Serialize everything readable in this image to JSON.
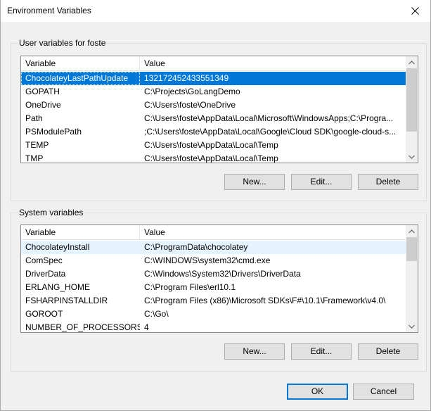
{
  "window": {
    "title": "Environment Variables"
  },
  "user_vars": {
    "group_label": "User variables for foste",
    "columns": [
      "Variable",
      "Value"
    ],
    "rows": [
      [
        "ChocolateyLastPathUpdate",
        "132172452433551349"
      ],
      [
        "GOPATH",
        "C:\\Projects\\GoLangDemo"
      ],
      [
        "OneDrive",
        "C:\\Users\\foste\\OneDrive"
      ],
      [
        "Path",
        "C:\\Users\\foste\\AppData\\Local\\Microsoft\\WindowsApps;C:\\Progra..."
      ],
      [
        "PSModulePath",
        ";C:\\Users\\foste\\AppData\\Local\\Google\\Cloud SDK\\google-cloud-s..."
      ],
      [
        "TEMP",
        "C:\\Users\\foste\\AppData\\Local\\Temp"
      ],
      [
        "TMP",
        "C:\\Users\\foste\\AppData\\Local\\Temp"
      ]
    ],
    "selected_index": 0,
    "buttons": {
      "new": "New...",
      "edit": "Edit...",
      "delete": "Delete"
    }
  },
  "sys_vars": {
    "group_label": "System variables",
    "columns": [
      "Variable",
      "Value"
    ],
    "rows": [
      [
        "ChocolateyInstall",
        "C:\\ProgramData\\chocolatey"
      ],
      [
        "ComSpec",
        "C:\\WINDOWS\\system32\\cmd.exe"
      ],
      [
        "DriverData",
        "C:\\Windows\\System32\\Drivers\\DriverData"
      ],
      [
        "ERLANG_HOME",
        "C:\\Program Files\\erl10.1"
      ],
      [
        "FSHARPINSTALLDIR",
        "C:\\Program Files (x86)\\Microsoft SDKs\\F#\\10.1\\Framework\\v4.0\\"
      ],
      [
        "GOROOT",
        "C:\\Go\\"
      ],
      [
        "NUMBER_OF_PROCESSORS",
        "4"
      ]
    ],
    "hover_index": 0,
    "buttons": {
      "new": "New...",
      "edit": "Edit...",
      "delete": "Delete"
    }
  },
  "footer": {
    "ok": "OK",
    "cancel": "Cancel"
  },
  "colors": {
    "selection": "#0078d7",
    "hover": "#e5f3ff",
    "window_bg": "#f0f0f0"
  },
  "icons": [
    "close-icon",
    "scroll-up-icon",
    "scroll-down-icon"
  ]
}
